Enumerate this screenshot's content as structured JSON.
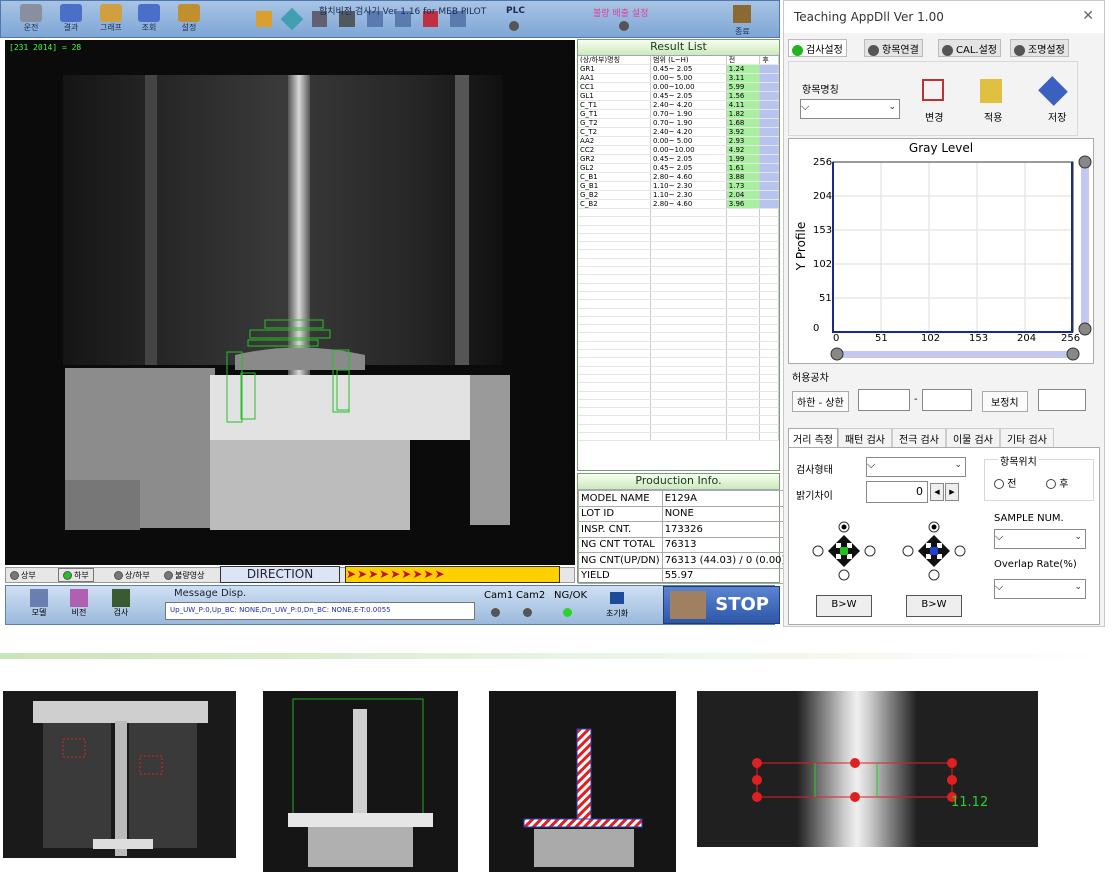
{
  "app": {
    "title": "합치비전 검사기 Ver 1.16 for MEB PILOT",
    "plc_label": "PLC",
    "ng_setting_label": "불량 배출 설정",
    "exit_label": "종료"
  },
  "toolbar": [
    {
      "label": "운전",
      "icon": "run-icon"
    },
    {
      "label": "결과",
      "icon": "result-icon"
    },
    {
      "label": "그래프",
      "icon": "graph-icon"
    },
    {
      "label": "조회",
      "icon": "search-icon"
    },
    {
      "label": "설정",
      "icon": "settings-icon"
    }
  ],
  "camera": {
    "coord_text": "[231 2014] = 28"
  },
  "result_list": {
    "title": "Result List",
    "headers": [
      "(상/하부)명칭",
      "범위 (L~H)",
      "전",
      "후"
    ],
    "rows": [
      [
        "GR1",
        "0.45~ 2.05",
        "1.24",
        ""
      ],
      [
        "AA1",
        "0.00~ 5.00",
        "3.11",
        ""
      ],
      [
        "CC1",
        "0.00~10.00",
        "5.99",
        ""
      ],
      [
        "GL1",
        "0.45~ 2.05",
        "1.56",
        ""
      ],
      [
        "C_T1",
        "2.40~ 4.20",
        "4.11",
        ""
      ],
      [
        "G_T1",
        "0.70~ 1.90",
        "1.82",
        ""
      ],
      [
        "G_T2",
        "0.70~ 1.90",
        "1.68",
        ""
      ],
      [
        "C_T2",
        "2.40~ 4.20",
        "3.92",
        ""
      ],
      [
        "AA2",
        "0.00~ 5.00",
        "2.93",
        ""
      ],
      [
        "CC2",
        "0.00~10.00",
        "4.92",
        ""
      ],
      [
        "GR2",
        "0.45~ 2.05",
        "1.99",
        ""
      ],
      [
        "GL2",
        "0.45~ 2.05",
        "1.61",
        ""
      ],
      [
        "C_B1",
        "2.80~ 4.60",
        "3.88",
        ""
      ],
      [
        "G_B1",
        "1.10~ 2.30",
        "1.73",
        ""
      ],
      [
        "G_B2",
        "1.10~ 2.30",
        "2.04",
        ""
      ],
      [
        "C_B2",
        "2.80~ 4.60",
        "3.96",
        ""
      ]
    ]
  },
  "production": {
    "title": "Production Info.",
    "rows": [
      [
        "MODEL NAME",
        "E129A"
      ],
      [
        "LOT ID",
        "NONE"
      ],
      [
        "INSP. CNT.",
        "173326"
      ],
      [
        "NG CNT TOTAL",
        "76313"
      ],
      [
        "NG CNT(UP/DN)",
        "76313 (44.03) / 0 (0.00)"
      ],
      [
        "YIELD",
        "55.97"
      ]
    ]
  },
  "view_options": [
    "상부",
    "하부",
    "상/하부",
    "불량영상"
  ],
  "direction_label": "DIRECTION",
  "bottom": {
    "buttons": [
      "모델",
      "비전",
      "검사"
    ],
    "message_title": "Message Disp.",
    "message_text": "Up_UW_P:0,Up_BC:    NONE,Dn_UW_P:0,Dn_BC:    NONE,E-T:0.0055",
    "cam1": "Cam1",
    "cam2": "Cam2",
    "ngok": "NG/OK",
    "reset": "초기화",
    "stop": "STOP"
  },
  "dialog": {
    "title": "Teaching AppDll Ver 1.00",
    "tabs": [
      "검사설정",
      "항목연결",
      "CAL.설정",
      "조명설정"
    ],
    "item_name_label": "항목명칭",
    "actions": [
      "변경",
      "적용",
      "저장"
    ],
    "graph_title": "Gray Level",
    "y_axis_label": "Y Profile",
    "y_ticks": [
      "256",
      "204",
      "153",
      "102",
      "51",
      "0"
    ],
    "x_ticks": [
      "0",
      "51",
      "102",
      "153",
      "204",
      "256"
    ],
    "tolerance_label": "허용공차",
    "lowhigh_label": "하한 - 상한",
    "dash": "-",
    "correction_label": "보정치",
    "subtabs": [
      "거리 측정",
      "패턴 검사",
      "전극 검사",
      "이물 검사",
      "기타 검사"
    ],
    "inspect_type_label": "검사형태",
    "brightness_label": "밝기차이",
    "brightness_value": "0",
    "position_label": "항목위치",
    "pos_front": "전",
    "pos_back": "후",
    "sample_label": "SAMPLE NUM.",
    "overlap_label": "Overlap Rate(%)",
    "bw_label": "B>W"
  },
  "thumb_label": "11.12",
  "colors": {
    "accent_green": "#1eb81e",
    "stop_blue": "#2d56a8",
    "value_green": "#a8f0a0"
  }
}
